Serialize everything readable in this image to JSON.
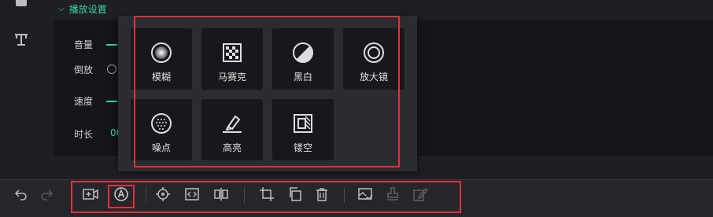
{
  "settings": {
    "section_title": "播放设置",
    "rows": {
      "volume": "音量",
      "reverse": "倒放",
      "speed": "速度",
      "duration": "时长"
    },
    "duration_value_fragment": "00"
  },
  "effects_popup": {
    "items": [
      {
        "label": "模糊",
        "icon": "blur-icon"
      },
      {
        "label": "马赛克",
        "icon": "mosaic-icon"
      },
      {
        "label": "黑白",
        "icon": "black-white-icon"
      },
      {
        "label": "放大镜",
        "icon": "magnifier-icon"
      },
      {
        "label": "噪点",
        "icon": "noise-icon"
      },
      {
        "label": "高亮",
        "icon": "highlight-icon"
      },
      {
        "label": "镂空",
        "icon": "hollow-icon"
      }
    ]
  },
  "toolbar": {
    "icons": [
      "undo-icon",
      "redo-icon",
      "add-video-clip-icon",
      "mask-effect-icon",
      "locate-icon",
      "code-frame-icon",
      "split-icon",
      "crop-icon",
      "copy-icon",
      "delete-icon",
      "image-check-icon",
      "stamp-icon",
      "edit-icon"
    ]
  },
  "colors": {
    "accent": "#3fcf9f",
    "highlight_box": "#e0323a",
    "popup_bg": "#2a2c31",
    "tile_bg": "#17181b"
  }
}
